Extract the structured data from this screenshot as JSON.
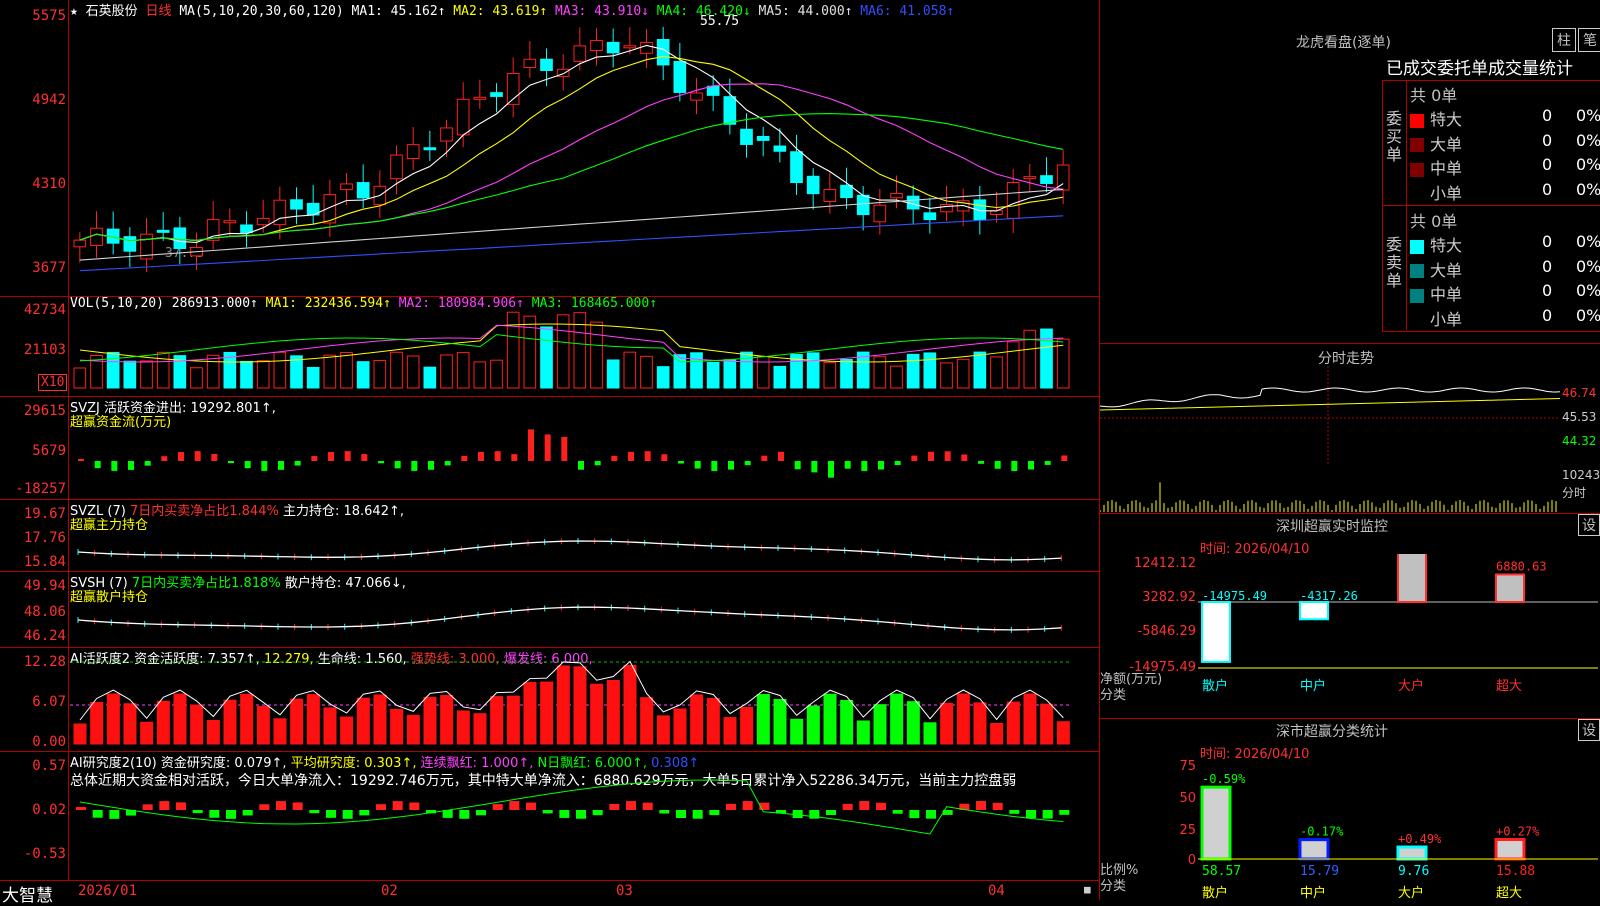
{
  "header": {
    "star": "★",
    "stock": "石英股份",
    "period": "日线",
    "ma_label": "MA(5,10,20,30,60,120)",
    "ma1": "MA1: 45.162↑",
    "ma2": "MA2: 43.619↑",
    "ma3": "MA3: 43.910↓",
    "ma4": "MA4: 46.420↓",
    "ma5": "MA5: 44.000↑",
    "ma6": "MA6: 41.058↑",
    "high_mark": "55.75",
    "low_mark": "37.73"
  },
  "price_axis": [
    "5575",
    "4942",
    "4310",
    "3677"
  ],
  "vol": {
    "label": "VOL(5,10,20)",
    "val": "286913.000↑",
    "ma1": "MA1: 232436.594↑",
    "ma2": "MA2: 180984.906↑",
    "ma3": "MA3: 168465.000↑",
    "axis": [
      "42734",
      "21103"
    ],
    "unit": "X10"
  },
  "svzj": {
    "label": "SVZJ  活跃资金进出: 19292.801↑,",
    "sub": "超赢资金流(万元)",
    "axis": [
      "29615",
      "5679",
      "-18257"
    ]
  },
  "svzl": {
    "label": "SVZL (7)",
    "pct": "7日内买卖净占比1.844%",
    "hold": "主力持仓: 18.642↑,",
    "sub": "超赢主力持仓",
    "axis": [
      "19.67",
      "17.76",
      "15.84"
    ]
  },
  "svsh": {
    "label": "SVSH (7)",
    "pct": "7日内买卖净占比1.818%",
    "hold": "散户持仓: 47.066↓,",
    "sub": "超赢散户持仓",
    "axis": [
      "49.94",
      "48.06",
      "46.24"
    ]
  },
  "ai1": {
    "label": "AI活跃度2 资金活跃度: 7.357↑,",
    "v2": "12.279,",
    "life": "生命线: 1.560,",
    "strong": "强势线: 3.000,",
    "burst": "爆发线: 6.000,",
    "axis": [
      "12.28",
      "6.07",
      "0.00"
    ]
  },
  "ai2": {
    "label": "AI研究度2(10) 资金研究度: 0.079↑,",
    "avg": "平均研究度: 0.303↑,",
    "red": "连续飘红: 1.000↑,",
    "nred": "N日飘红: 6.000↑,",
    "last": "0.308↑",
    "summary": "总体近期大资金相对活跃，今日大单净流入：19292.746万元，其中特大单净流入：6880.629万元，大单5日累计净入52286.34万元，当前主力控盘弱",
    "axis": [
      "0.57",
      "0.02",
      "-0.53"
    ]
  },
  "footer": {
    "logo": "大智慧",
    "dates": [
      "2026/01",
      "02",
      "03",
      "04"
    ]
  },
  "dragon": {
    "title": "龙虎看盘(逐单)",
    "btn1": "柱",
    "btn2": "笔",
    "tabs": "已成交委托单成交量统计",
    "buy_label": "委买单",
    "sell_label": "委卖单",
    "buy_total": "共 0单",
    "sell_total": "共 0单",
    "buy_rows": [
      {
        "name": "特大",
        "v": "0",
        "p": "0%",
        "c": "#ff0000"
      },
      {
        "name": "大单",
        "v": "0",
        "p": "0%",
        "c": "#800000"
      },
      {
        "name": "中单",
        "v": "0",
        "p": "0%",
        "c": "#800000"
      },
      {
        "name": "小单",
        "v": "0",
        "p": "0%",
        "c": "#000000"
      }
    ],
    "sell_rows": [
      {
        "name": "特大",
        "v": "0",
        "p": "0%",
        "c": "#00ffff"
      },
      {
        "name": "大单",
        "v": "0",
        "p": "0%",
        "c": "#008080"
      },
      {
        "name": "中单",
        "v": "0",
        "p": "0%",
        "c": "#008080"
      },
      {
        "name": "小单",
        "v": "0",
        "p": "0%",
        "c": "#000000"
      }
    ]
  },
  "intraday": {
    "title": "分时走势",
    "axis": [
      "46.74",
      "45.53",
      "44.32"
    ],
    "vol_axis": "10243",
    "vol_label": "分时"
  },
  "monitor": {
    "title": "深圳超赢实时监控",
    "btn": "设",
    "time": "时间: 2026/04/10",
    "axis": [
      "12412.12",
      "3282.92",
      "-5846.29",
      "-14975.49"
    ],
    "ylabel": "净额(万元)",
    "xlabel": "分类",
    "cats": [
      "散户",
      "中户",
      "大户",
      "超大"
    ],
    "values": [
      "-14975.49",
      "-4317.26",
      "12412.12",
      "6880.63"
    ]
  },
  "stats": {
    "title": "深市超赢分类统计",
    "btn": "设",
    "time": "时间: 2026/04/10",
    "axis": [
      "75",
      "50",
      "25",
      "0"
    ],
    "ylabel": "比例%",
    "xlabel": "分类",
    "cats": [
      "散户",
      "中户",
      "大户",
      "超大"
    ],
    "pct": [
      "-0.59%",
      "-0.17%",
      "+0.49%",
      "+0.27%"
    ],
    "vals": [
      "58.57",
      "15.79",
      "9.76",
      "15.88"
    ]
  },
  "colors": {
    "up": "#ff2020",
    "down": "#00ffff",
    "border": "#b00000"
  }
}
